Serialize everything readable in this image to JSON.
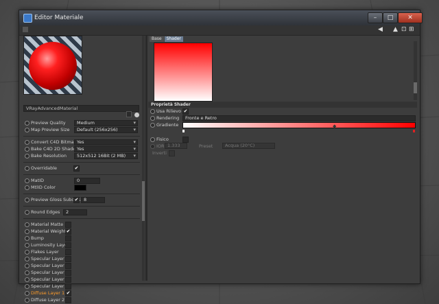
{
  "window": {
    "title": "Editor Materiale",
    "controls": {
      "minimize": "–",
      "maximize": "□",
      "close": "✕"
    }
  },
  "toolbar": {
    "icons": [
      "arrow-left-icon",
      "arrow-up-icon",
      "lock-icon",
      "expand-icon"
    ],
    "glyphs": {
      "back": "◀",
      "up": "▲",
      "lock": "⊡",
      "expand": "⊞"
    }
  },
  "material": {
    "name": "VRayAdvancedMaterial"
  },
  "left_panel": {
    "preview_quality": {
      "label": "Preview Quality",
      "value": "Medium"
    },
    "map_preview_size": {
      "label": "Map Preview Size",
      "value": "Default (256x256)"
    },
    "convert_c4d_bitmaps": {
      "label": "Convert C4D Bitmaps",
      "value": "Yes"
    },
    "bake_c4d_2d_shaders": {
      "label": "Bake C4D 2D Shaders",
      "value": "Yes"
    },
    "bake_resolution": {
      "label": "Bake Resolution",
      "value": "512x512  16Bit  (2 MB)"
    },
    "overridable": {
      "label": "Overridable",
      "checked": "✔"
    },
    "matid": {
      "label": "MatID",
      "value": "0"
    },
    "matid_color": {
      "label": "MtlID Color",
      "color": "#000000"
    },
    "preview_gloss_subdivs": {
      "label": "Preview Gloss Subdivs",
      "checked": "✔",
      "value": "8"
    },
    "round_edges": {
      "label": "Round Edges",
      "value": "2"
    },
    "layers": [
      {
        "label": "Material Matte",
        "checked": ""
      },
      {
        "label": "Material Weight",
        "checked": "✔"
      },
      {
        "label": "Bump",
        "checked": ""
      },
      {
        "label": "Luminosity Layer",
        "checked": ""
      },
      {
        "label": "Flakes Layer",
        "checked": ""
      },
      {
        "label": "Specular Layer 5",
        "checked": ""
      },
      {
        "label": "Specular Layer 4",
        "checked": ""
      },
      {
        "label": "Specular Layer 3",
        "checked": ""
      },
      {
        "label": "Specular Layer 2",
        "checked": ""
      },
      {
        "label": "Specular Layer 1",
        "checked": ""
      },
      {
        "label": "Diffuse Layer 1",
        "checked": "✔",
        "active": true
      },
      {
        "label": "Diffuse Layer 2",
        "checked": ""
      }
    ]
  },
  "right_panel": {
    "tabs": [
      "Base",
      "Shader"
    ],
    "active_tab": "Shader",
    "section_title": "Proprietà Shader",
    "usa_rilievo": {
      "label": "Usa Rilievo",
      "checked": "✔"
    },
    "rendering": {
      "label": "Rendering",
      "value": "Fronte e Retro"
    },
    "gradiente": {
      "label": "Gradiente",
      "start_color": "#ffffff",
      "end_color": "#ff0000"
    },
    "fisico": {
      "label": "Fisico",
      "checked": ""
    },
    "ior": {
      "label": "IOR",
      "value": "1.333"
    },
    "preselezione": {
      "label": "Preset",
      "value": "Acqua (20°C)"
    },
    "inverti": {
      "label": "Inverti",
      "checked": ""
    }
  },
  "colors": {
    "accent": "#6a7c93",
    "active_layer": "#ff9c2a",
    "gradient_top": "#ff0000",
    "gradient_bottom": "#ffffff"
  }
}
